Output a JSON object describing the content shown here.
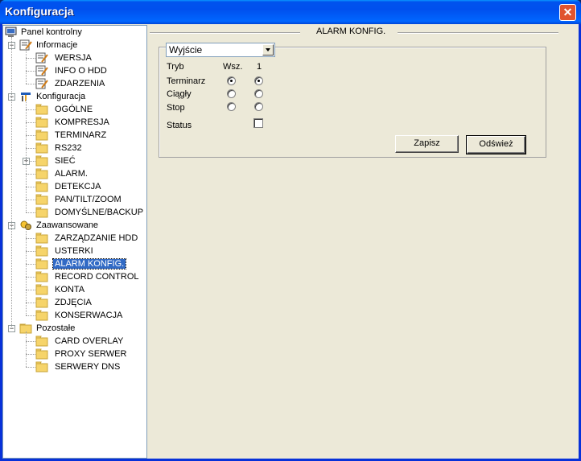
{
  "window": {
    "title": "Konfiguracja",
    "close_glyph": "✕"
  },
  "tree": {
    "root": "Panel kontrolny",
    "groups": [
      {
        "label": "Informacje",
        "expander": "−",
        "items": [
          "WERSJA",
          "INFO O HDD",
          "ZDARZENIA"
        ]
      },
      {
        "label": "Konfiguracja",
        "expander": "−",
        "items": [
          "OGÓLNE",
          "KOMPRESJA",
          "TERMINARZ",
          "RS232",
          "SIEĆ",
          "ALARM.",
          "DETEKCJA",
          "PAN/TILT/ZOOM",
          "DOMYŚLNE/BACKUP"
        ],
        "collapsed_item_expander": "+"
      },
      {
        "label": "Zaawansowane",
        "expander": "−",
        "items": [
          "ZARZĄDZANIE HDD",
          "USTERKI",
          "ALARM KONFIG.",
          "RECORD CONTROL",
          "KONTA",
          "ZDJĘCIA",
          "KONSERWACJA"
        ]
      },
      {
        "label": "Pozostałe",
        "expander": "−",
        "items": [
          "CARD OVERLAY",
          "PROXY SERWER",
          "SERWERY DNS"
        ]
      }
    ],
    "selected": "ALARM KONFIG."
  },
  "main": {
    "section_title": "ALARM KONFIG.",
    "select": {
      "value": "Wyjście"
    },
    "headers": {
      "mode": "Tryb",
      "all": "Wsz.",
      "ch1": "1"
    },
    "rows": [
      {
        "label": "Terminarz",
        "all_selected": true,
        "ch1_selected": true
      },
      {
        "label": "Ciągły",
        "all_selected": false,
        "ch1_selected": false
      },
      {
        "label": "Stop",
        "all_selected": false,
        "ch1_selected": false
      }
    ],
    "status_label": "Status",
    "status_checked": false,
    "buttons": {
      "save": "Zapisz",
      "refresh": "Odśwież"
    }
  }
}
